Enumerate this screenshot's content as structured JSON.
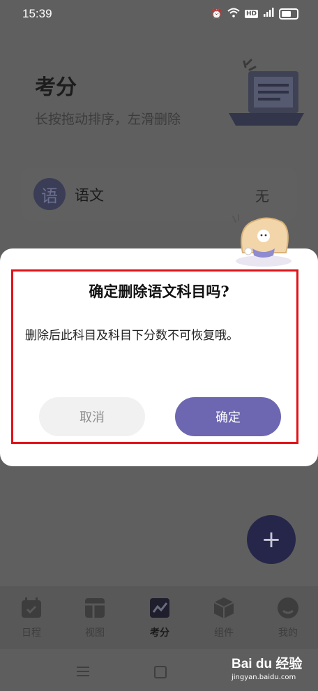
{
  "status_bar": {
    "time": "15:39",
    "hd_badge": "HD",
    "signal_badge": "4G"
  },
  "page": {
    "title": "考分",
    "subtitle": "长按拖动排序，左滑删除"
  },
  "subjects": [
    {
      "avatar": "语",
      "name": "语文",
      "score": "无"
    }
  ],
  "dialog": {
    "title": "确定删除语文科目吗?",
    "message": "删除后此科目及科目下分数不可恢复哦。",
    "cancel_label": "取消",
    "confirm_label": "确定"
  },
  "fab": {
    "icon": "plus-icon",
    "label": "+"
  },
  "tabs": [
    {
      "label": "日程",
      "icon": "calendar-check-icon",
      "active": false
    },
    {
      "label": "视图",
      "icon": "layout-grid-icon",
      "active": false
    },
    {
      "label": "考分",
      "icon": "chart-line-icon",
      "active": true
    },
    {
      "label": "组件",
      "icon": "cube-icon",
      "active": false
    },
    {
      "label": "我的",
      "icon": "profile-icon",
      "active": false
    }
  ],
  "watermark": {
    "brand": "Bai du 经验",
    "url": "jingyan.baidu.com"
  },
  "colors": {
    "accent": "#6d67b1",
    "highlight": "#e01218",
    "fab": "#26264a"
  }
}
